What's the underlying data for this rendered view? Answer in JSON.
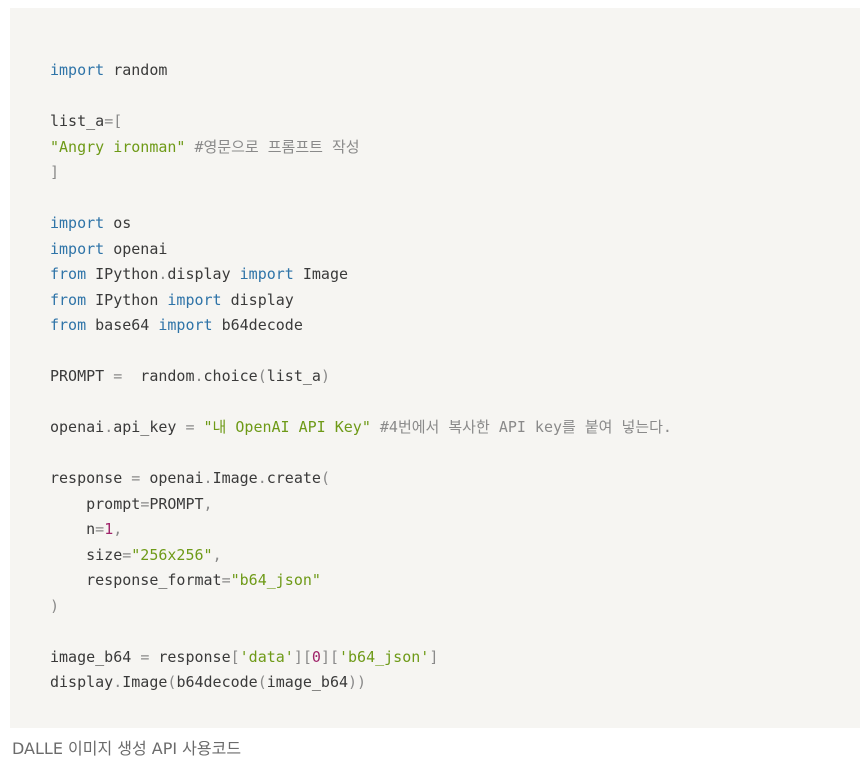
{
  "code_block": {
    "lines": [
      [
        {
          "t": "import",
          "c": "kw"
        },
        {
          "t": " random",
          "c": ""
        }
      ],
      [],
      [
        {
          "t": "list_a",
          "c": ""
        },
        {
          "t": "=[",
          "c": "op"
        }
      ],
      [
        {
          "t": "\"Angry ironman\"",
          "c": "str"
        },
        {
          "t": " #영문으로 프롬프트 작성",
          "c": "cmt"
        }
      ],
      [
        {
          "t": "]",
          "c": "op"
        }
      ],
      [],
      [
        {
          "t": "import",
          "c": "kw"
        },
        {
          "t": " os",
          "c": ""
        }
      ],
      [
        {
          "t": "import",
          "c": "kw"
        },
        {
          "t": " openai",
          "c": ""
        }
      ],
      [
        {
          "t": "from",
          "c": "kw"
        },
        {
          "t": " IPython",
          "c": ""
        },
        {
          "t": ".",
          "c": "op"
        },
        {
          "t": "display ",
          "c": ""
        },
        {
          "t": "import",
          "c": "kw"
        },
        {
          "t": " Image",
          "c": ""
        }
      ],
      [
        {
          "t": "from",
          "c": "kw"
        },
        {
          "t": " IPython ",
          "c": ""
        },
        {
          "t": "import",
          "c": "kw"
        },
        {
          "t": " display",
          "c": ""
        }
      ],
      [
        {
          "t": "from",
          "c": "kw"
        },
        {
          "t": " base64 ",
          "c": ""
        },
        {
          "t": "import",
          "c": "kw"
        },
        {
          "t": " b64decode",
          "c": ""
        }
      ],
      [],
      [
        {
          "t": "PROMPT ",
          "c": ""
        },
        {
          "t": "=",
          "c": "op"
        },
        {
          "t": "  random",
          "c": ""
        },
        {
          "t": ".",
          "c": "op"
        },
        {
          "t": "choice",
          "c": ""
        },
        {
          "t": "(",
          "c": "op"
        },
        {
          "t": "list_a",
          "c": ""
        },
        {
          "t": ")",
          "c": "op"
        }
      ],
      [],
      [
        {
          "t": "openai",
          "c": ""
        },
        {
          "t": ".",
          "c": "op"
        },
        {
          "t": "api_key ",
          "c": ""
        },
        {
          "t": "=",
          "c": "op"
        },
        {
          "t": " ",
          "c": ""
        },
        {
          "t": "\"내 OpenAI API Key\"",
          "c": "str"
        },
        {
          "t": " #4번에서 복사한 API key를 붙여 넣는다.",
          "c": "cmt"
        }
      ],
      [],
      [
        {
          "t": "response ",
          "c": ""
        },
        {
          "t": "=",
          "c": "op"
        },
        {
          "t": " openai",
          "c": ""
        },
        {
          "t": ".",
          "c": "op"
        },
        {
          "t": "Image",
          "c": ""
        },
        {
          "t": ".",
          "c": "op"
        },
        {
          "t": "create",
          "c": ""
        },
        {
          "t": "(",
          "c": "op"
        }
      ],
      [
        {
          "t": "    prompt",
          "c": ""
        },
        {
          "t": "=",
          "c": "op"
        },
        {
          "t": "PROMPT",
          "c": ""
        },
        {
          "t": ",",
          "c": "op"
        }
      ],
      [
        {
          "t": "    n",
          "c": ""
        },
        {
          "t": "=",
          "c": "op"
        },
        {
          "t": "1",
          "c": "num"
        },
        {
          "t": ",",
          "c": "op"
        }
      ],
      [
        {
          "t": "    size",
          "c": ""
        },
        {
          "t": "=",
          "c": "op"
        },
        {
          "t": "\"256x256\"",
          "c": "str"
        },
        {
          "t": ",",
          "c": "op"
        }
      ],
      [
        {
          "t": "    response_format",
          "c": ""
        },
        {
          "t": "=",
          "c": "op"
        },
        {
          "t": "\"b64_json\"",
          "c": "str"
        }
      ],
      [
        {
          "t": ")",
          "c": "op"
        }
      ],
      [],
      [
        {
          "t": "image_b64 ",
          "c": ""
        },
        {
          "t": "=",
          "c": "op"
        },
        {
          "t": " response",
          "c": ""
        },
        {
          "t": "[",
          "c": "op"
        },
        {
          "t": "'data'",
          "c": "str"
        },
        {
          "t": "][",
          "c": "op"
        },
        {
          "t": "0",
          "c": "num"
        },
        {
          "t": "][",
          "c": "op"
        },
        {
          "t": "'b64_json'",
          "c": "str"
        },
        {
          "t": "]",
          "c": "op"
        }
      ],
      [
        {
          "t": "display",
          "c": ""
        },
        {
          "t": ".",
          "c": "op"
        },
        {
          "t": "Image",
          "c": ""
        },
        {
          "t": "(",
          "c": "op"
        },
        {
          "t": "b64decode",
          "c": ""
        },
        {
          "t": "(",
          "c": "op"
        },
        {
          "t": "image_b64",
          "c": ""
        },
        {
          "t": "))",
          "c": "op"
        }
      ]
    ]
  },
  "caption": "DALLE 이미지 생성 API 사용코드",
  "colors": {
    "keyword": "#2f74a8",
    "string": "#6e9a17",
    "number": "#a0246a",
    "operator": "#8a8a8a",
    "text": "#3a3a3a",
    "background": "#f6f5f2"
  }
}
